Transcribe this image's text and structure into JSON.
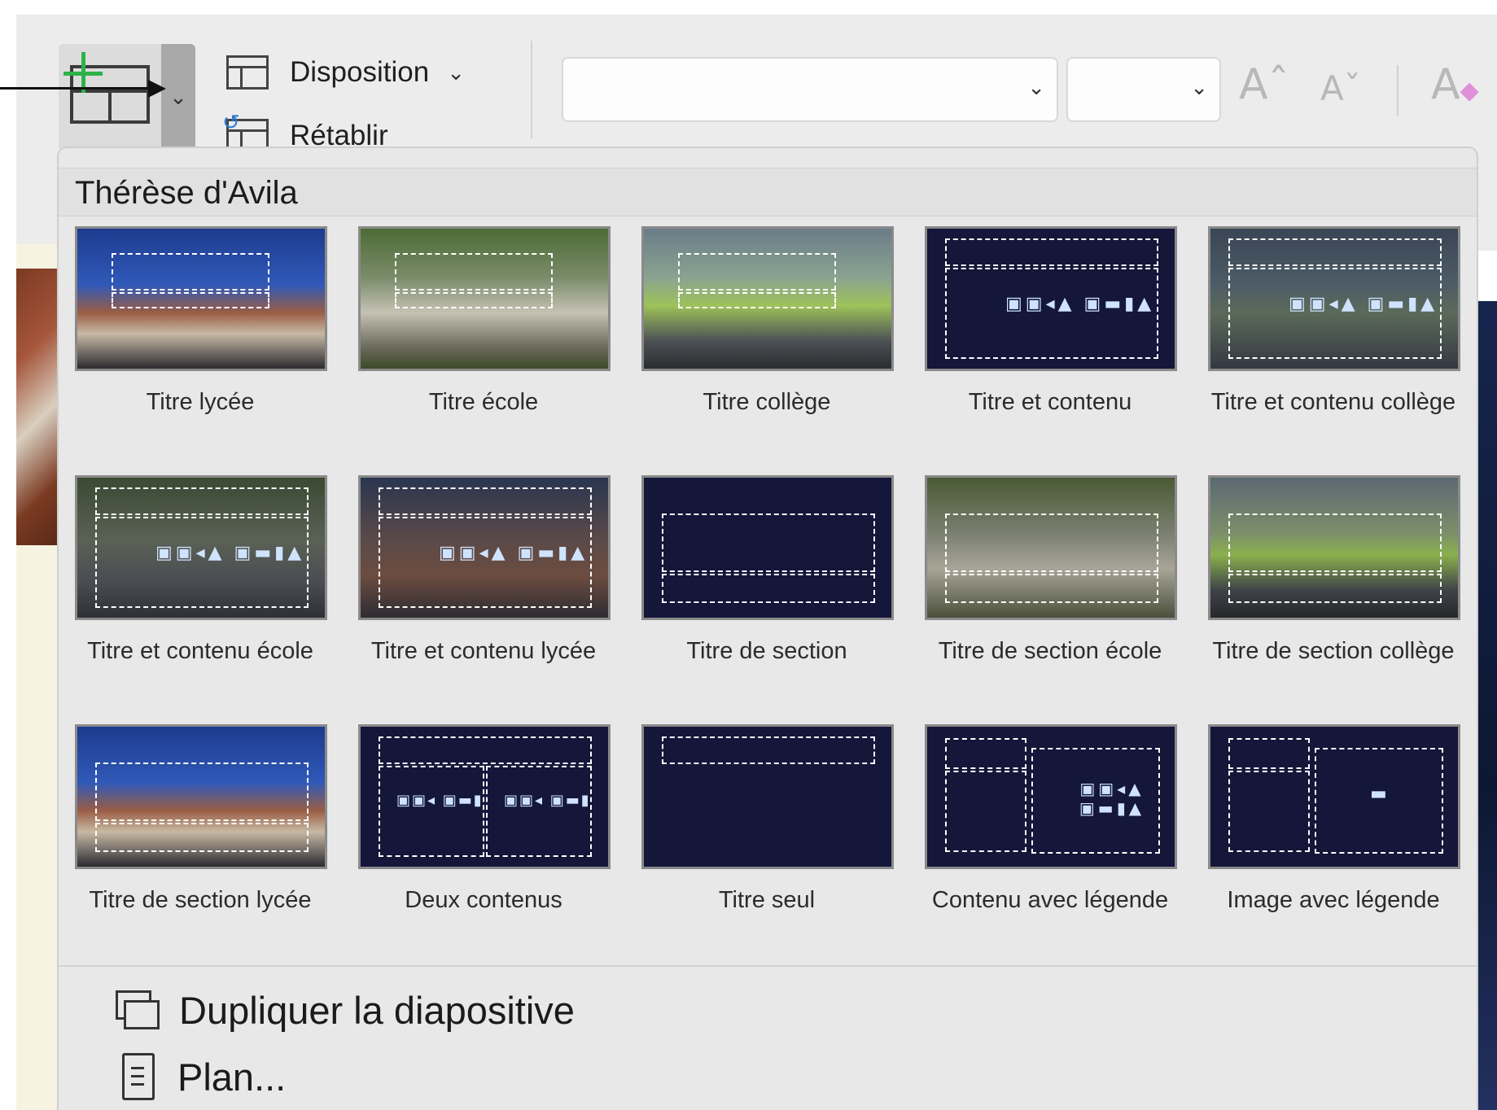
{
  "ribbon": {
    "new_slide_dropdown": "⌄",
    "layout_label": "Disposition",
    "layout_chevron": "⌄",
    "reset_label": "Rétablir",
    "font_dropdown": "⌄",
    "size_dropdown": "⌄",
    "grow_font": "Aˆ",
    "shrink_font": "Aˇ",
    "clear_format": "A"
  },
  "panel": {
    "title": "Thérèse d'Avila",
    "layouts": [
      {
        "label": "Titre lycée"
      },
      {
        "label": "Titre école"
      },
      {
        "label": "Titre collège"
      },
      {
        "label": "Titre et contenu"
      },
      {
        "label": "Titre et contenu collège"
      },
      {
        "label": "Titre et contenu école"
      },
      {
        "label": "Titre et contenu lycée"
      },
      {
        "label": "Titre de section"
      },
      {
        "label": "Titre de section école"
      },
      {
        "label": "Titre de section collège"
      },
      {
        "label": "Titre de section lycée"
      },
      {
        "label": "Deux contenus"
      },
      {
        "label": "Titre seul"
      },
      {
        "label": "Contenu avec légende"
      },
      {
        "label": "Image avec légende"
      }
    ],
    "duplicate_label": "Dupliquer la diapositive",
    "outline_label": "Plan..."
  },
  "icons": {
    "content_glyphs": "▣▣◂▲ ▣▬▮▲",
    "image_glyph": "▬"
  }
}
